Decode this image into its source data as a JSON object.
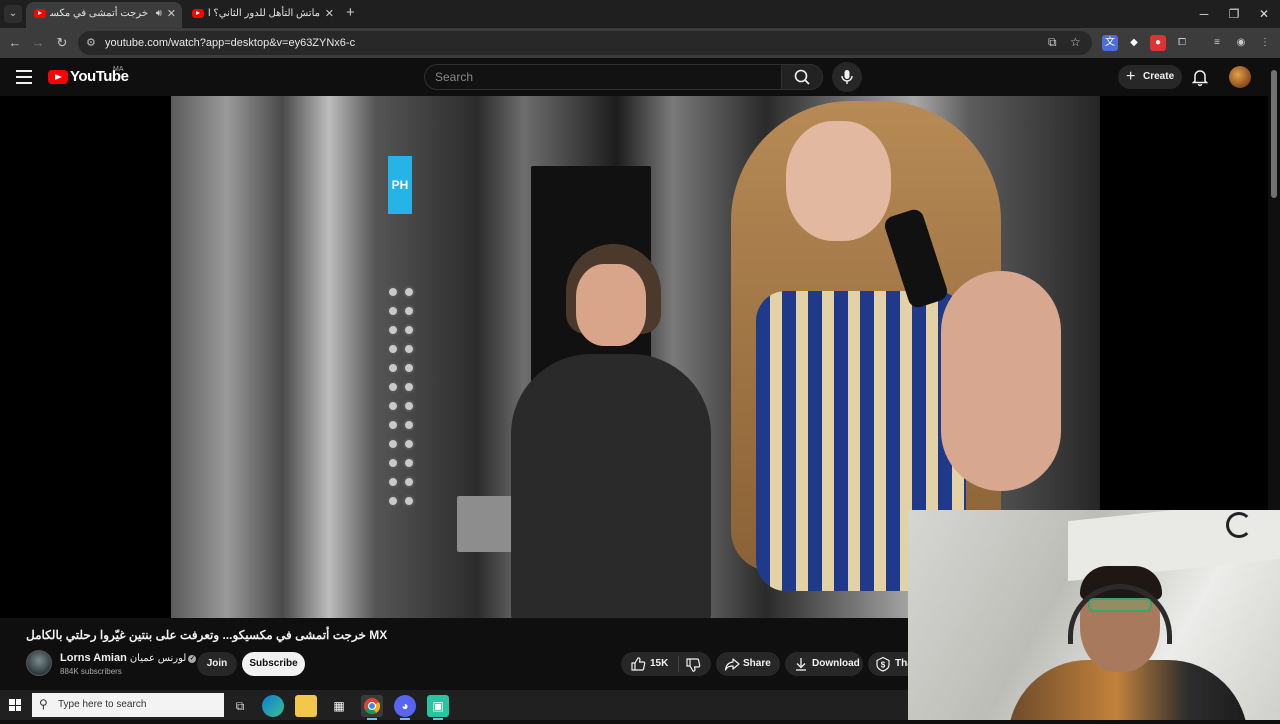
{
  "browser": {
    "tabs": [
      {
        "title": "خرجت أتمشى في مكسيكو...",
        "active": true,
        "audio": true
      },
      {
        "title": "ماتش التأهل للدور الثاني؟ التشك...",
        "active": false,
        "audio": false
      }
    ],
    "new_tab_label": "+",
    "url": "youtube.com/watch?app=desktop&v=ey63ZYNx6-c",
    "window_controls": [
      "minimize",
      "restore",
      "close"
    ]
  },
  "youtube": {
    "logo_text": "YouTube",
    "country_code": "MA",
    "search_placeholder": "Search",
    "create_label": "Create"
  },
  "video": {
    "elevator_sign": "PH",
    "title": "خرجت أتمشى في مكسيكو... وتعرفت على بنتين غيّروا رحلتي بالكامل MX",
    "channel": {
      "name": "Lorns Amian",
      "name_ar": "لورنس عميان",
      "verified": true,
      "subscribers": "884K subscribers"
    },
    "join_label": "Join",
    "subscribe_label": "Subscribe",
    "likes": "15K",
    "share_label": "Share",
    "download_label": "Download",
    "thanks_label": "Thanks"
  },
  "taskbar": {
    "search_placeholder": "Type here to search",
    "apps": [
      "task-view",
      "edge",
      "file-explorer",
      "store",
      "chrome",
      "discord",
      "app"
    ]
  },
  "colors": {
    "youtube_red": "#ff0000",
    "page_bg": "#0f0f0f",
    "chip_bg": "#272727",
    "subscribe_bg": "#f1f1f1",
    "elevator_sign": "#26b3e6"
  }
}
